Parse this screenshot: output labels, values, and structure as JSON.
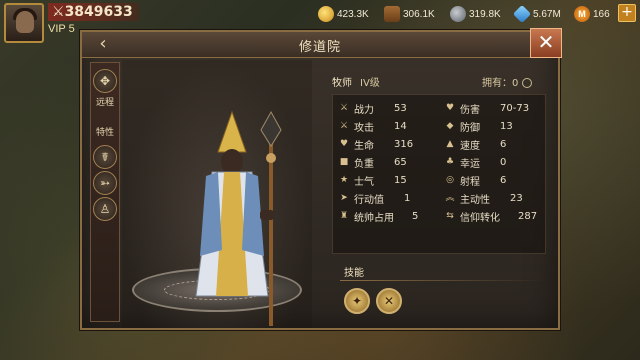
{
  "player": {
    "power": "3849633",
    "vip": "VIP 5"
  },
  "resources": [
    {
      "icon": "gold-coins-icon",
      "value": "423.3K"
    },
    {
      "icon": "wood-logs-icon",
      "value": "306.1K"
    },
    {
      "icon": "iron-ore-icon",
      "value": "319.8K"
    },
    {
      "icon": "crystal-icon",
      "value": "5.67M"
    },
    {
      "icon": "m-currency-icon",
      "value": "166"
    }
  ],
  "panel": {
    "title": "修道院",
    "back_glyph": "‹",
    "close_glyph": "✕"
  },
  "leftbar": {
    "ranged_label": "远程",
    "traits_label": "特性"
  },
  "unit": {
    "name": "牧师",
    "level": "IV级",
    "owned": "拥有：0"
  },
  "stats": [
    {
      "icon": "crossed-swords-icon",
      "glyph": "⚔",
      "name": "战力",
      "value": "53"
    },
    {
      "icon": "heart-damage-icon",
      "glyph": "♥",
      "name": "伤害",
      "value": "70-73"
    },
    {
      "icon": "sword-icon",
      "glyph": "⚔",
      "name": "攻击",
      "value": "14"
    },
    {
      "icon": "shield-icon",
      "glyph": "◆",
      "name": "防御",
      "value": "13"
    },
    {
      "icon": "heart-icon",
      "glyph": "♥",
      "name": "生命",
      "value": "316"
    },
    {
      "icon": "boot-icon",
      "glyph": "▲",
      "name": "速度",
      "value": "6"
    },
    {
      "icon": "weight-icon",
      "glyph": "■",
      "name": "负重",
      "value": "65"
    },
    {
      "icon": "clover-icon",
      "glyph": "♣",
      "name": "幸运",
      "value": "0"
    },
    {
      "icon": "morale-icon",
      "glyph": "★",
      "name": "士气",
      "value": "15"
    },
    {
      "icon": "target-icon",
      "glyph": "◎",
      "name": "射程",
      "value": "6"
    },
    {
      "icon": "runner-icon",
      "glyph": "➤",
      "name": "行动值",
      "value": "1"
    },
    {
      "icon": "chevrons-up-icon",
      "glyph": "︽",
      "name": "主动性",
      "value": "23"
    },
    {
      "icon": "command-icon",
      "glyph": "♜",
      "name": "统帅占用",
      "value": "5"
    },
    {
      "icon": "faith-convert-icon",
      "glyph": "⇆",
      "name": "信仰转化",
      "value": "287"
    }
  ],
  "skills": {
    "title": "技能",
    "items": [
      {
        "icon": "holy-shield-skill-icon",
        "glyph": "✦"
      },
      {
        "icon": "crossed-weapons-skill-icon",
        "glyph": "✕"
      }
    ]
  }
}
